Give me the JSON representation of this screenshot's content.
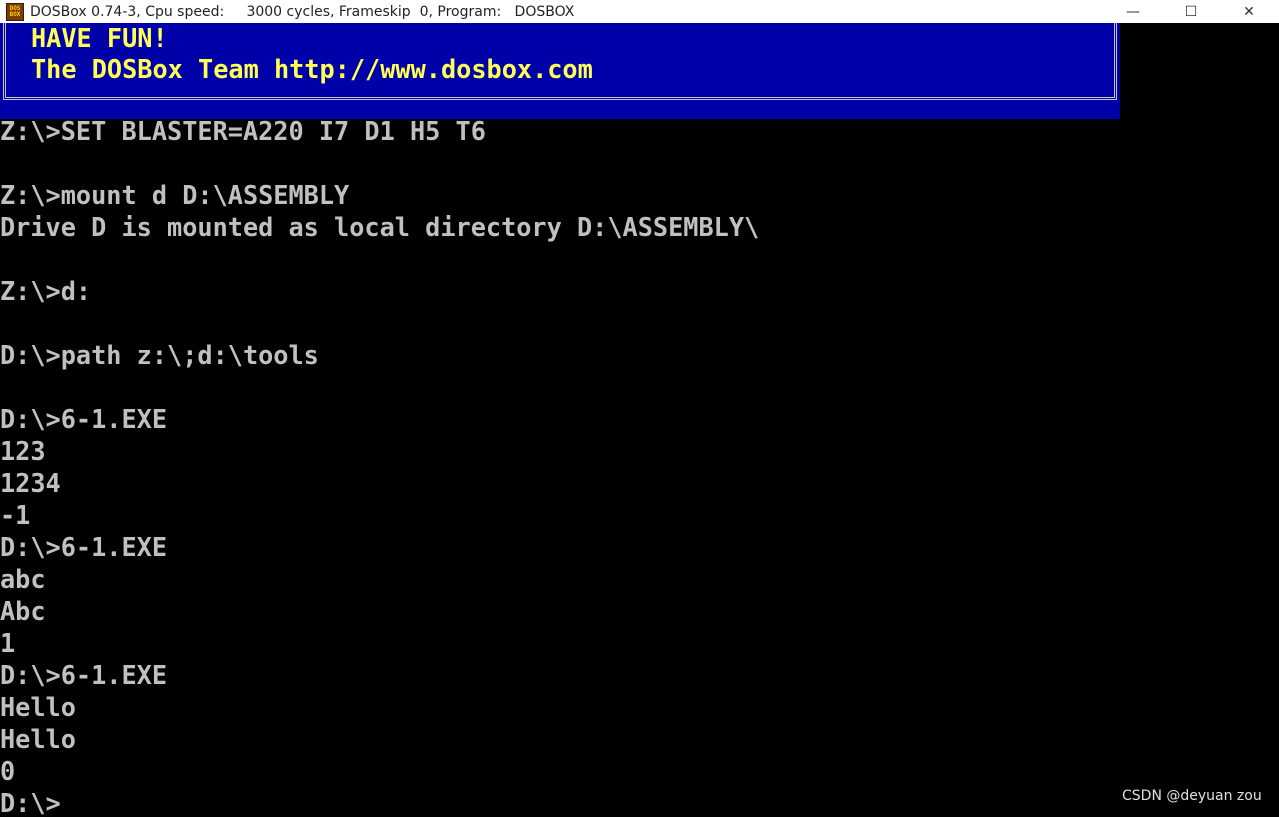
{
  "window": {
    "title": "DOSBox 0.74-3, Cpu speed:     3000 cycles, Frameskip  0, Program:   DOSBOX",
    "icon": "dosbox-icon",
    "icon_text_top": "DOS",
    "icon_text_bottom": "BOX",
    "controls": {
      "minimize_icon": "—",
      "maximize_icon": "☐",
      "close_icon": "✕"
    }
  },
  "banner": {
    "line1": "HAVE FUN!",
    "line2_prefix": "The DOSBox Team ",
    "line2_url": "http://www.dosbox.com",
    "background_color": "#0000a8",
    "text_color": "#ffff55"
  },
  "console": {
    "text_color": "#c0c0c0",
    "lines": [
      "Z:\\>SET BLASTER=A220 I7 D1 H5 T6",
      "",
      "Z:\\>mount d D:\\ASSEMBLY",
      "Drive D is mounted as local directory D:\\ASSEMBLY\\",
      "",
      "Z:\\>d:",
      "",
      "D:\\>path z:\\;d:\\tools",
      "",
      "D:\\>6-1.EXE",
      "123",
      "1234",
      "-1",
      "D:\\>6-1.EXE",
      "abc",
      "Abc",
      "1",
      "D:\\>6-1.EXE",
      "Hello",
      "Hello",
      "0",
      "D:\\>"
    ]
  },
  "watermark": "CSDN @deyuan zou"
}
